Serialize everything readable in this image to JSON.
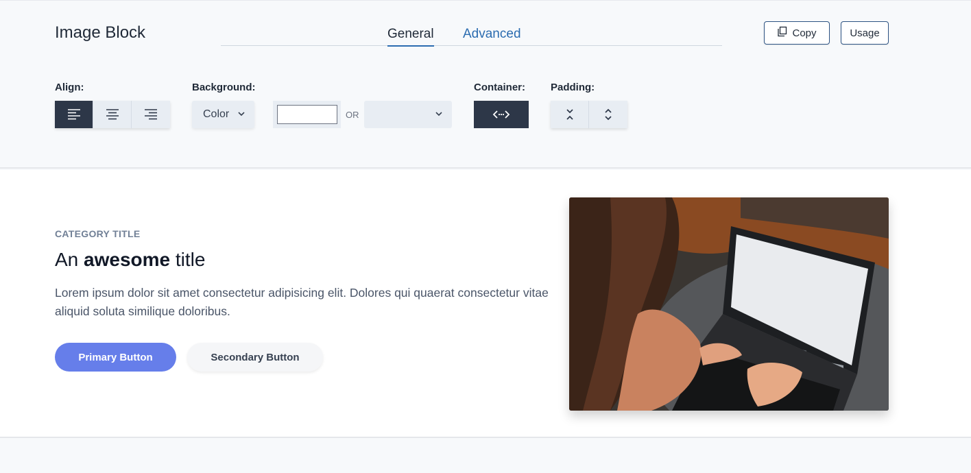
{
  "header": {
    "title": "Image Block",
    "tabs": [
      {
        "label": "General",
        "active": true
      },
      {
        "label": "Advanced",
        "active": false
      }
    ],
    "copy_label": "Copy",
    "usage_label": "Usage"
  },
  "controls": {
    "align_label": "Align:",
    "align_options": [
      "align-left-icon",
      "align-center-icon",
      "align-right-icon"
    ],
    "align_selected": "left",
    "background_label": "Background:",
    "background_select": "Color",
    "color_value": "",
    "or_label": "OR",
    "background_image_select": "",
    "container_label": "Container:",
    "padding_label": "Padding:",
    "padding_options": [
      "padding-collapse-icon",
      "padding-expand-icon"
    ]
  },
  "preview": {
    "category": "CATEGORY TITLE",
    "title_pre": "An ",
    "title_bold": "awesome",
    "title_post": " title",
    "description": "Lorem ipsum dolor sit amet consectetur adipisicing elit. Dolores qui quaerat consectetur vitae aliquid soluta similique doloribus.",
    "primary_button": "Primary Button",
    "secondary_button": "Secondary Button",
    "image": "woman-typing-on-laptop-photo"
  },
  "colors": {
    "dark": "#2d3748",
    "accent": "#2b6cb0",
    "primary_button": "#667eea",
    "control_bg": "#e8edf3"
  }
}
